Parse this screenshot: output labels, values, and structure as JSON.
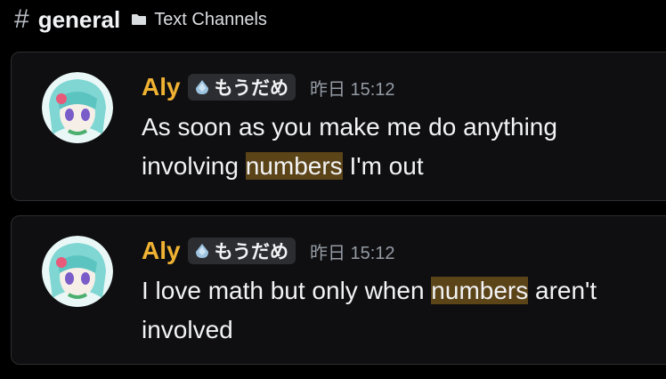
{
  "header": {
    "channel_symbol": "#",
    "channel_name": "general",
    "category": "Text Channels"
  },
  "messages": [
    {
      "author": "Aly",
      "tag": "もうだめ",
      "timestamp": "昨日 15:12",
      "text_before": "As soon as you make me do anything involving ",
      "highlight": "numbers",
      "text_after": " I'm out"
    },
    {
      "author": "Aly",
      "tag": "もうだめ",
      "timestamp": "昨日 15:12",
      "text_before": "I love math but only when ",
      "highlight": "numbers",
      "text_after": " aren't involved"
    }
  ],
  "colors": {
    "author": "#f0b232",
    "highlight": "#5c4419",
    "card_bg": "#0f0f11"
  }
}
